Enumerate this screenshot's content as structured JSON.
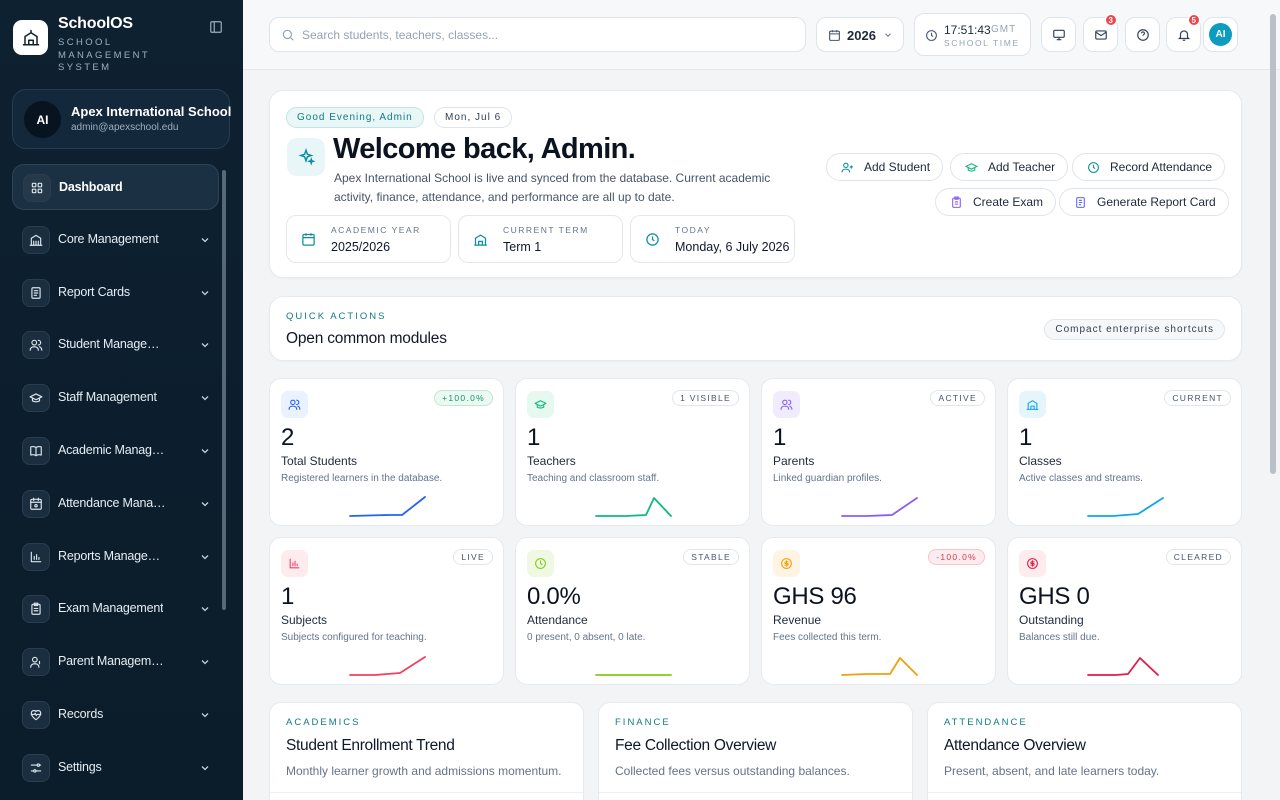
{
  "brand": {
    "name": "SchoolOS",
    "subtitle": "SCHOOL MANAGEMENT SYSTEM"
  },
  "school": {
    "initials": "AI",
    "name": "Apex International School",
    "email": "admin@apexschool.edu"
  },
  "nav": [
    {
      "label": "Dashboard",
      "icon": "dashboard-icon",
      "active": true
    },
    {
      "label": "Core Management",
      "icon": "building-icon"
    },
    {
      "label": "Report Cards",
      "icon": "report-card-icon"
    },
    {
      "label": "Student Management",
      "icon": "users-icon"
    },
    {
      "label": "Staff Management",
      "icon": "graduation-cap-icon"
    },
    {
      "label": "Academic Management",
      "icon": "book-icon"
    },
    {
      "label": "Attendance Management",
      "icon": "calendar-icon"
    },
    {
      "label": "Reports Management",
      "icon": "bar-chart-icon"
    },
    {
      "label": "Exam Management",
      "icon": "clipboard-icon"
    },
    {
      "label": "Parent Management",
      "icon": "parent-icon"
    },
    {
      "label": "Records",
      "icon": "heart-icon"
    },
    {
      "label": "Settings",
      "icon": "sliders-icon"
    }
  ],
  "topbar": {
    "search_placeholder": "Search students, teachers, classes...",
    "year": "2026",
    "time": "17:51:43",
    "timezone": "GMT",
    "time_label": "SCHOOL TIME",
    "mail_badge": "3",
    "notif_badge": "5",
    "user_initials": "AI"
  },
  "welcome": {
    "greeting": "Good Evening, Admin",
    "date_pill": "Mon, Jul 6",
    "title": "Welcome back, Admin.",
    "text": "Apex International School is live and synced from the database. Current academic activity, finance, attendance, and performance are all up to date.",
    "info": [
      {
        "key": "ACADEMIC YEAR",
        "value": "2025/2026"
      },
      {
        "key": "CURRENT TERM",
        "value": "Term 1"
      },
      {
        "key": "TODAY",
        "value": "Monday, 6 July 2026"
      }
    ],
    "actions": [
      "Add Student",
      "Add Teacher",
      "Record Attendance",
      "Create Exam",
      "Generate Report Card"
    ]
  },
  "quick": {
    "kicker": "QUICK ACTIONS",
    "title": "Open common modules",
    "pill": "Compact enterprise shortcuts"
  },
  "stats": [
    {
      "value": "2",
      "label": "Total Students",
      "desc": "Registered learners in the database.",
      "tag": "+100.0%",
      "color": "#2563eb"
    },
    {
      "value": "1",
      "label": "Teachers",
      "desc": "Teaching and classroom staff.",
      "tag": "1 VISIBLE",
      "color": "#10b981"
    },
    {
      "value": "1",
      "label": "Parents",
      "desc": "Linked guardian profiles.",
      "tag": "ACTIVE",
      "color": "#8b5cf6"
    },
    {
      "value": "1",
      "label": "Classes",
      "desc": "Active classes and streams.",
      "tag": "CURRENT",
      "color": "#0ea5e9"
    },
    {
      "value": "1",
      "label": "Subjects",
      "desc": "Subjects configured for teaching.",
      "tag": "LIVE",
      "color": "#f43f5e"
    },
    {
      "value": "0.0%",
      "label": "Attendance",
      "desc": "0 present, 0 absent, 0 late.",
      "tag": "STABLE",
      "color": "#84cc16"
    },
    {
      "value": "GHS 96",
      "label": "Revenue",
      "desc": "Fees collected this term.",
      "tag": "-100.0%",
      "color": "#f59e0b"
    },
    {
      "value": "GHS 0",
      "label": "Outstanding",
      "desc": "Balances still due.",
      "tag": "CLEARED",
      "color": "#e11d48"
    }
  ],
  "overviews": [
    {
      "kicker": "ACADEMICS",
      "title": "Student Enrollment Trend",
      "desc": "Monthly learner growth and admissions momentum."
    },
    {
      "kicker": "FINANCE",
      "title": "Fee Collection Overview",
      "desc": "Collected fees versus outstanding balances."
    },
    {
      "kicker": "ATTENDANCE",
      "title": "Attendance Overview",
      "desc": "Present, absent, and late learners today."
    }
  ]
}
